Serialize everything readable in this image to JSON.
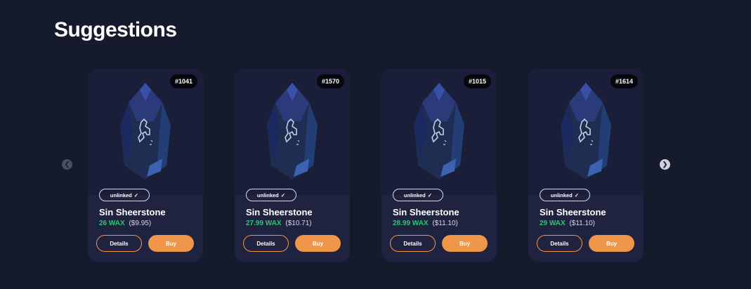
{
  "section": {
    "title": "Suggestions"
  },
  "carousel": {
    "prev_icon": "chevron-left-icon",
    "next_icon": "chevron-right-icon"
  },
  "cards": [
    {
      "id": "#1041",
      "status": "unlinked",
      "name": "Sin Sheerstone",
      "price_wax": "26 WAX",
      "price_usd": "($9.95)",
      "details_label": "Details",
      "buy_label": "Buy"
    },
    {
      "id": "#1570",
      "status": "unlinked",
      "name": "Sin Sheerstone",
      "price_wax": "27.99 WAX",
      "price_usd": "($10.71)",
      "details_label": "Details",
      "buy_label": "Buy"
    },
    {
      "id": "#1015",
      "status": "unlinked",
      "name": "Sin Sheerstone",
      "price_wax": "28.99 WAX",
      "price_usd": "($11.10)",
      "details_label": "Details",
      "buy_label": "Buy"
    },
    {
      "id": "#1614",
      "status": "unlinked",
      "name": "Sin Sheerstone",
      "price_wax": "29 WAX",
      "price_usd": "($11.10)",
      "details_label": "Details",
      "buy_label": "Buy"
    }
  ],
  "colors": {
    "background": "#151a2d",
    "card": "#1f2340",
    "wax_green": "#2fc17a",
    "accent_orange": "#f0964a"
  }
}
